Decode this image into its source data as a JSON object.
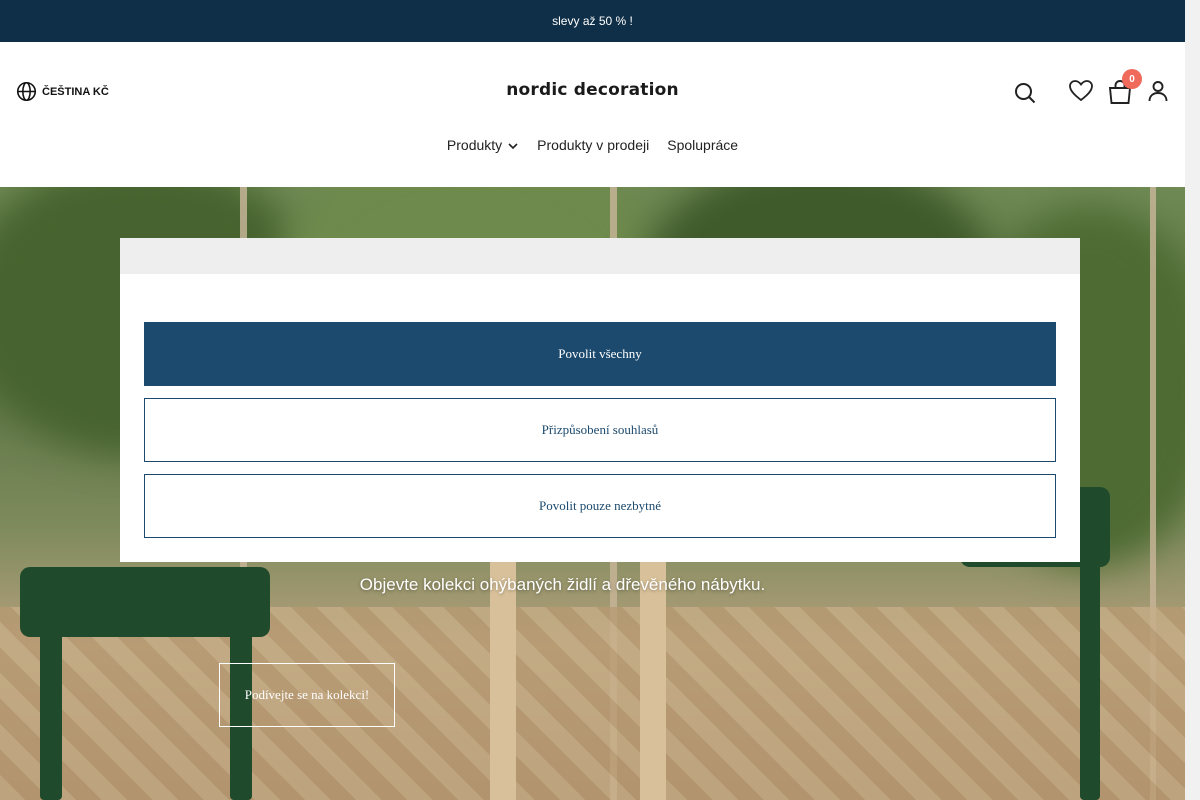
{
  "announcement": {
    "text": "slevy až 50 % !"
  },
  "header": {
    "language_currency": "ČEŠTINA KČ",
    "logo": "nordic decoration",
    "cart_count": "0",
    "icons": [
      "globe-icon",
      "search-icon",
      "heart-icon",
      "bag-icon",
      "user-icon"
    ]
  },
  "nav": {
    "items": [
      {
        "label": "Produkty",
        "has_dropdown": true
      },
      {
        "label": "Produkty v prodeji",
        "has_dropdown": false
      },
      {
        "label": "Spolupráce",
        "has_dropdown": false
      }
    ]
  },
  "hero": {
    "tagline": "Objevte kolekci ohýbaných židlí a dřevěného nábytku.",
    "cta_label": "Podívejte se na kolekci!"
  },
  "consent": {
    "allow_all_label": "Povolit všechny",
    "customize_label": "Přizpůsobení souhlasů",
    "necessary_only_label": "Povolit pouze nezbytné"
  },
  "colors": {
    "announcement_bg": "#0f2f48",
    "primary_button": "#1c4a6e",
    "badge": "#f06a5c"
  }
}
